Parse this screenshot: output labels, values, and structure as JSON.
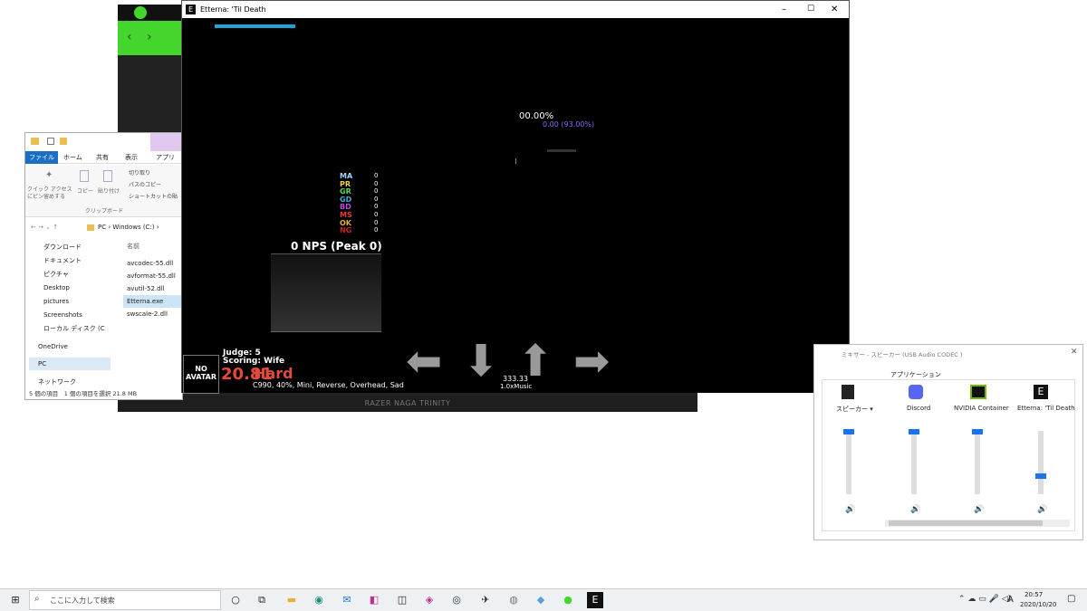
{
  "game_window": {
    "title": "Etterna: 'Til Death",
    "percent": "00.00%",
    "sub_percent": "0.00 (93.00%)",
    "judges": [
      {
        "label": "MA",
        "count": "0",
        "color": "#9fd6ff"
      },
      {
        "label": "PR",
        "count": "0",
        "color": "#f2d04a"
      },
      {
        "label": "GR",
        "count": "0",
        "color": "#5ed35a"
      },
      {
        "label": "GD",
        "count": "0",
        "color": "#3ab0d8"
      },
      {
        "label": "BD",
        "count": "0",
        "color": "#c04bd8"
      },
      {
        "label": "MS",
        "count": "0",
        "color": "#e43c3c"
      },
      {
        "label": "OK",
        "count": "0",
        "color": "#e8b02e"
      },
      {
        "label": "NG",
        "count": "0",
        "color": "#c92020"
      }
    ],
    "nps": "0 NPS (Peak 0)",
    "judge_line": "Judge: 5",
    "scoring_line": "Scoring: Wife",
    "difficulty_number": "20.81",
    "difficulty_name": "Hard",
    "mods": "C990, 40%, Mini, Reverse, Overhead, Sad",
    "bpm": "333.33",
    "rate": "1.0xMusic",
    "avatar_text": "NO AVATAR"
  },
  "razer": {
    "brand": "RAZER NAGA TRINITY"
  },
  "explorer": {
    "tabs": [
      "ファイル",
      "ホーム",
      "共有",
      "表示",
      "アプリケー"
    ],
    "ribbon_items": [
      "クイック アクセス にピン留めする",
      "コピー",
      "貼り付け",
      "切り取り",
      "パスのコピー",
      "ショートカットの貼"
    ],
    "clipboard_label": "クリップボード",
    "address": "PC › Windows (C:) ›",
    "sidebar": [
      "ダウンロード",
      "ドキュメント",
      "ピクチャ",
      "Desktop",
      "pictures",
      "Screenshots",
      "ローカル ディスク (C",
      "OneDrive",
      "PC",
      "ネットワーク"
    ],
    "name_header": "名前",
    "files": [
      "avcodec-55.dll",
      "avformat-55.dll",
      "avutil-52.dll",
      "Etterna.exe",
      "swscale-2.dll"
    ],
    "status": "5 個の項目　1 個の項目を選択 21.8 MB"
  },
  "mixer": {
    "title": "ミキサー - スピーカー (USB Audio CODEC )",
    "section": "アプリケーション",
    "device_label": "スピーカー",
    "apps": [
      "Discord",
      "NVIDIA Container",
      "Etterna: 'Til Death"
    ],
    "levels": [
      1.0,
      1.0,
      1.0,
      0.3
    ]
  },
  "taskbar": {
    "search_placeholder": "ここに入力して検索",
    "time": "20:57",
    "date": "2020/10/20",
    "ime": "A"
  }
}
